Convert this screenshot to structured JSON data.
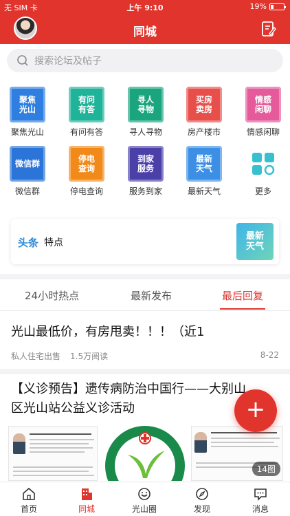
{
  "status": {
    "carrier": "无 SIM 卡",
    "time": "上午 9:10",
    "battery": "19%"
  },
  "header": {
    "title": "同城"
  },
  "search": {
    "placeholder": "搜索论坛及帖子"
  },
  "grid": [
    {
      "label": "聚焦光山",
      "tile_text": [
        "聚焦",
        "光山"
      ],
      "color": "#2e7fe0",
      "icon": "focus-guangshan-icon"
    },
    {
      "label": "有问有答",
      "tile_text": [
        "有问",
        "有答"
      ],
      "color": "#1fb39a",
      "icon": "qa-icon"
    },
    {
      "label": "寻人寻物",
      "tile_text": [
        "寻人",
        "寻物"
      ],
      "color": "#1aa57e",
      "icon": "lost-found-icon"
    },
    {
      "label": "房产楼市",
      "tile_text": [
        "买房",
        "卖房"
      ],
      "color": "#e84f4a",
      "icon": "real-estate-icon"
    },
    {
      "label": "情感闲聊",
      "tile_text": [
        "情感",
        "闲聊"
      ],
      "color": "#e45a9b",
      "icon": "chat-icon"
    },
    {
      "label": "微信群",
      "tile_text": [
        "微信群"
      ],
      "color": "#2b74d8",
      "icon": "wechat-group-icon"
    },
    {
      "label": "停电查询",
      "tile_text": [
        "停电",
        "查询"
      ],
      "color": "#f28a1a",
      "icon": "power-outage-icon"
    },
    {
      "label": "服务到家",
      "tile_text": [
        "到家",
        "服务"
      ],
      "color": "#4b3fa8",
      "icon": "home-service-icon"
    },
    {
      "label": "最新天气",
      "tile_text": [
        "最新",
        "天气"
      ],
      "color": "#3d8fe6",
      "icon": "weather-icon"
    },
    {
      "label": "更多",
      "tile_text": [],
      "color": "#38c0cf",
      "icon": "more-grid-icon"
    }
  ],
  "headline": {
    "tag": "头条",
    "text": "特点",
    "thumb_text": [
      "最新",
      "天气"
    ]
  },
  "tabs": [
    "24小时热点",
    "最新发布",
    "最后回复"
  ],
  "active_tab": 2,
  "posts": [
    {
      "title": "光山最低价，有房甩卖！！！（近1",
      "category": "私人住宅出售",
      "views": "1.5万阅读",
      "date": "8-22"
    },
    {
      "title_line1": "【义诊预告】遗传病防治中国行——大别山",
      "title_line2": "区光山站公益义诊活动",
      "image_count": "14图"
    }
  ],
  "fab": {
    "label": "+"
  },
  "nav": [
    {
      "label": "首页",
      "icon": "home-icon"
    },
    {
      "label": "同城",
      "icon": "city-icon"
    },
    {
      "label": "光山圈",
      "icon": "circle-icon"
    },
    {
      "label": "发现",
      "icon": "compass-icon"
    },
    {
      "label": "消息",
      "icon": "message-icon"
    }
  ],
  "colors": {
    "brand_red": "#e0342d",
    "headline_blue": "#2e8bd8"
  }
}
